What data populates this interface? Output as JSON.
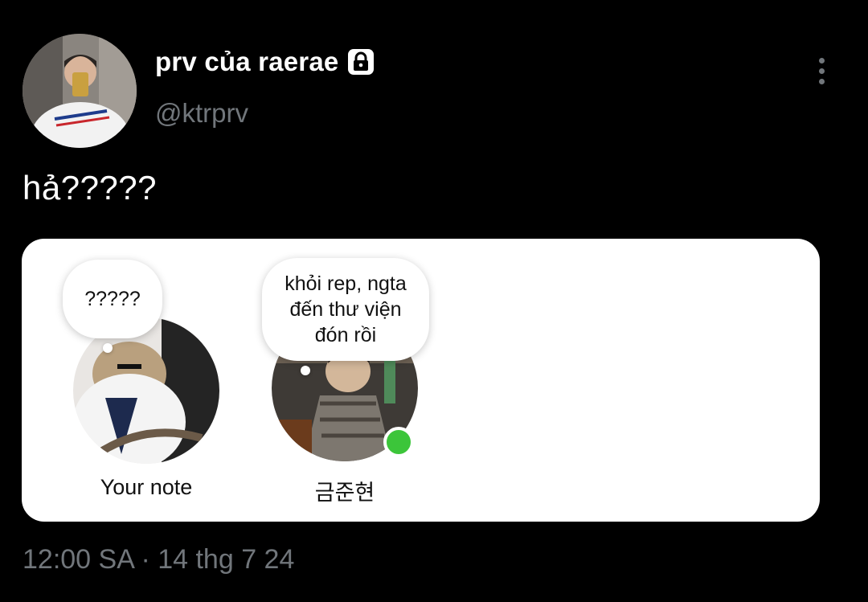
{
  "user": {
    "display_name": "prv của raerae",
    "handle": "@ktrprv",
    "protected_icon": "lock-icon"
  },
  "tweet": {
    "text": "hả?????",
    "timestamp": "12:00 SA · 14 thg 7 24"
  },
  "more_icon": "more-vertical-icon",
  "notes_card": {
    "items": [
      {
        "name": "Your note",
        "note": "?????",
        "online": false
      },
      {
        "name": "금준현",
        "note": "khỏi rep, ngta\nđến thư viện\nđón rồi",
        "online": true
      }
    ]
  },
  "colors": {
    "background": "#000000",
    "secondary_text": "#71767b",
    "online": "#3cc53a"
  }
}
